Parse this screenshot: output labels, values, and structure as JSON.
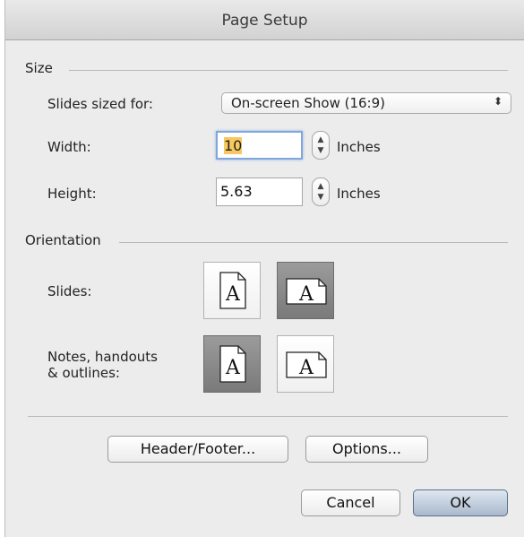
{
  "window": {
    "title": "Page Setup"
  },
  "size": {
    "heading": "Size",
    "slides_sized_for_label": "Slides sized for:",
    "slides_sized_for_value": "On-screen Show (16:9)",
    "popup_icon": "up-down-arrows-icon",
    "width_label": "Width:",
    "width_value": "10",
    "height_label": "Height:",
    "height_value": "5.63",
    "unit": "Inches"
  },
  "orientation": {
    "heading": "Orientation",
    "slides_label": "Slides:",
    "notes_label_line1": "Notes, handouts",
    "notes_label_line2": "& outlines:",
    "glyph": "A",
    "slides_selected": "landscape",
    "notes_selected": "portrait"
  },
  "buttons": {
    "header_footer": "Header/Footer...",
    "options": "Options...",
    "cancel": "Cancel",
    "ok": "OK"
  }
}
